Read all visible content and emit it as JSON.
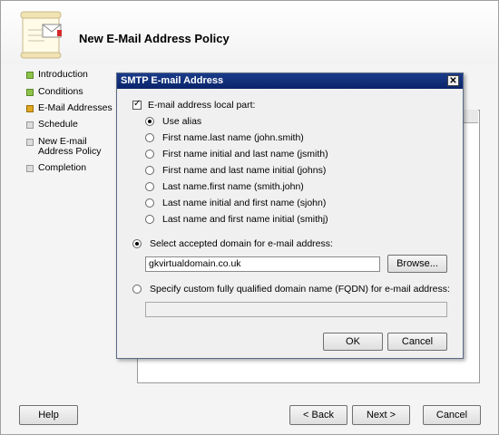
{
  "wizard": {
    "title": "New E-Mail Address Policy",
    "nav": [
      {
        "label": "Introduction",
        "state": "green"
      },
      {
        "label": "Conditions",
        "state": "green"
      },
      {
        "label": "E-Mail Addresses",
        "state": "yellow"
      },
      {
        "label": "Schedule",
        "state": "grey"
      },
      {
        "label": "New E-mail Address Policy",
        "state": "grey"
      },
      {
        "label": "Completion",
        "state": "grey"
      }
    ],
    "buttons": {
      "help": "Help",
      "back": "< Back",
      "next": "Next >",
      "cancel": "Cancel"
    }
  },
  "dialog": {
    "title": "SMTP E-mail Address",
    "close": "✕",
    "local_part_label": "E-mail address local part:",
    "local_part_checked": true,
    "options": [
      {
        "label": "Use alias",
        "checked": true
      },
      {
        "label": "First name.last name (john.smith)",
        "checked": false
      },
      {
        "label": "First name initial and last name (jsmith)",
        "checked": false
      },
      {
        "label": "First name and last name initial (johns)",
        "checked": false
      },
      {
        "label": "Last name.first name (smith.john)",
        "checked": false
      },
      {
        "label": "Last name initial and first name (sjohn)",
        "checked": false
      },
      {
        "label": "Last name and first name initial (smithj)",
        "checked": false
      }
    ],
    "accepted_domain_label": "Select accepted domain for e-mail address:",
    "accepted_domain_value": "gkvirtualdomain.co.uk",
    "browse": "Browse...",
    "fqdn_label": "Specify custom fully qualified domain name (FQDN) for e-mail address:",
    "fqdn_value": "",
    "ok": "OK",
    "cancel": "Cancel"
  },
  "colors": {
    "titlebar": "#0a246a",
    "nav_green": "#8ec34a",
    "nav_yellow": "#e0a820"
  }
}
